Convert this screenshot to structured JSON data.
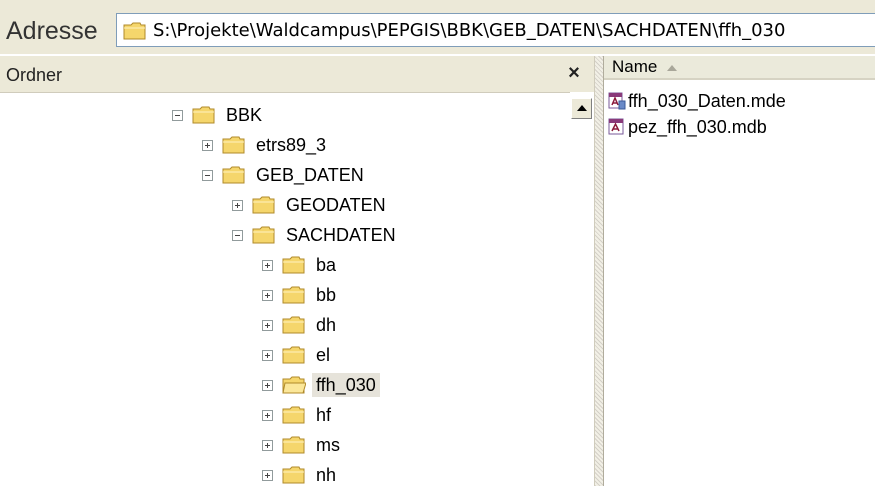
{
  "address": {
    "label": "Adresse",
    "path": "S:\\Projekte\\Waldcampus\\PEPGIS\\BBK\\GEB_DATEN\\SACHDATEN\\ffh_030"
  },
  "folders_pane": {
    "title": "Ordner",
    "close_label": "×",
    "nodes": [
      {
        "label": "BBK",
        "expanded": true
      },
      {
        "label": "etrs89_3",
        "expanded": false
      },
      {
        "label": "GEB_DATEN",
        "expanded": true
      },
      {
        "label": "GEODATEN",
        "expanded": false
      },
      {
        "label": "SACHDATEN",
        "expanded": true
      },
      {
        "label": "ba",
        "expanded": false
      },
      {
        "label": "bb",
        "expanded": false
      },
      {
        "label": "dh",
        "expanded": false
      },
      {
        "label": "el",
        "expanded": false
      },
      {
        "label": "ffh_030",
        "expanded": false,
        "selected": true
      },
      {
        "label": "hf",
        "expanded": false
      },
      {
        "label": "ms",
        "expanded": false
      },
      {
        "label": "nh",
        "expanded": false
      }
    ]
  },
  "file_list": {
    "column_header": "Name",
    "files": [
      {
        "name": "ffh_030_Daten.mde",
        "icon": "access-mde-icon"
      },
      {
        "name": "pez_ffh_030.mdb",
        "icon": "access-mdb-icon"
      }
    ]
  },
  "colors": {
    "chrome": "#ece9d8",
    "folder": "#f5d66c",
    "selection": "#e6e3da"
  }
}
